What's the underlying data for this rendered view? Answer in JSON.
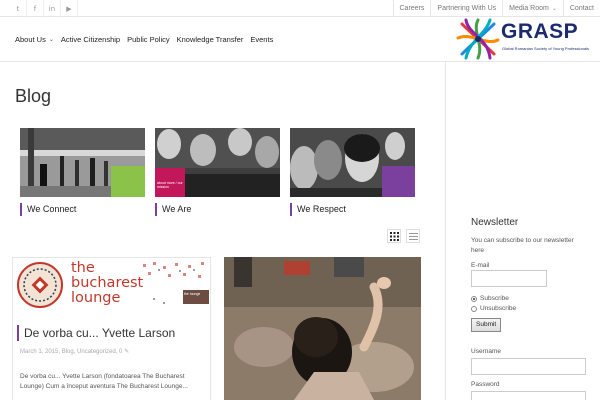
{
  "topbar": {
    "social_icons": [
      {
        "name": "twitter-icon",
        "glyph": "t"
      },
      {
        "name": "facebook-icon",
        "glyph": "f"
      },
      {
        "name": "linkedin-icon",
        "glyph": "in"
      },
      {
        "name": "youtube-icon",
        "glyph": "▶"
      }
    ],
    "links": [
      {
        "label": "Careers"
      },
      {
        "label": "Partnering With Us"
      },
      {
        "label": "Media Room",
        "has_dropdown": true
      },
      {
        "label": "Contact"
      }
    ]
  },
  "nav": {
    "items": [
      {
        "label": "About Us",
        "has_dropdown": true
      },
      {
        "label": "Active Citizenship"
      },
      {
        "label": "Public Policy"
      },
      {
        "label": "Knowledge Transfer"
      },
      {
        "label": "Events"
      }
    ]
  },
  "logo": {
    "text": "GRASP",
    "subtitle": "Global Romanian Society of Young Professionals",
    "colors": [
      "#e53935",
      "#fb8c00",
      "#43a047",
      "#1e88e5",
      "#8e24aa",
      "#1c2a6e"
    ]
  },
  "page": {
    "title": "Blog"
  },
  "featured": [
    {
      "caption": "We Connect"
    },
    {
      "caption": "We Are",
      "overlay_text": "about more / our mission"
    },
    {
      "caption": "We Respect"
    }
  ],
  "accent_color": "#7b3f9e",
  "posts": [
    {
      "image_title": "the bucharest lounge",
      "image_badge": "the lounge",
      "title": "De vorba cu... Yvette Larson",
      "meta": "March 1, 2015, Blog, Uncategorized, 0",
      "excerpt": "De vorba cu... Yvette Larson (fondatoarea The Bucharest Lounge)     Cum a început aventura The Bucharest Lounge..."
    }
  ],
  "sidebar": {
    "newsletter": {
      "title": "Newsletter",
      "description": "You can subscribe to our newsletter here",
      "email_label": "E-mail",
      "email_value": "",
      "options": [
        {
          "label": "Subscribe",
          "selected": true
        },
        {
          "label": "Unsubscribe",
          "selected": false
        }
      ],
      "submit_label": "Submit",
      "username_label": "Username",
      "password_label": "Password"
    }
  }
}
